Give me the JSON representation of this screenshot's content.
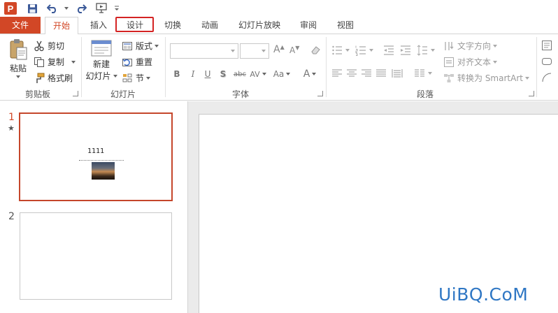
{
  "qat": {
    "app_logo": "P"
  },
  "tabs": {
    "file": "文件",
    "home": "开始",
    "insert": "插入",
    "design": "设计",
    "transitions": "切换",
    "animations": "动画",
    "slideshow": "幻灯片放映",
    "review": "审阅",
    "view": "视图"
  },
  "ribbon": {
    "clipboard": {
      "paste": "粘贴",
      "cut": "剪切",
      "copy": "复制",
      "format_painter": "格式刷",
      "group_label": "剪贴板"
    },
    "slides": {
      "new_slide_line1": "新建",
      "new_slide_line2": "幻灯片",
      "layout": "版式",
      "reset": "重置",
      "section": "节",
      "group_label": "幻灯片"
    },
    "font": {
      "bold": "B",
      "italic": "I",
      "underline": "U",
      "shadow": "S",
      "strikethrough": "abc",
      "spacing": "AV",
      "change_case": "Aa",
      "font_color": "A",
      "grow": "A",
      "shrink": "A",
      "group_label": "字体"
    },
    "paragraph": {
      "text_direction": "文字方向",
      "align_text": "对齐文本",
      "convert_smartart": "转换为 SmartArt",
      "group_label": "段落"
    }
  },
  "slides": [
    {
      "number": "1",
      "text": "1111"
    },
    {
      "number": "2"
    }
  ],
  "watermark": "UiBQ.CoM",
  "colors": {
    "accent": "#d24726",
    "highlight_box": "#d42424",
    "watermark": "#2f77c4"
  }
}
